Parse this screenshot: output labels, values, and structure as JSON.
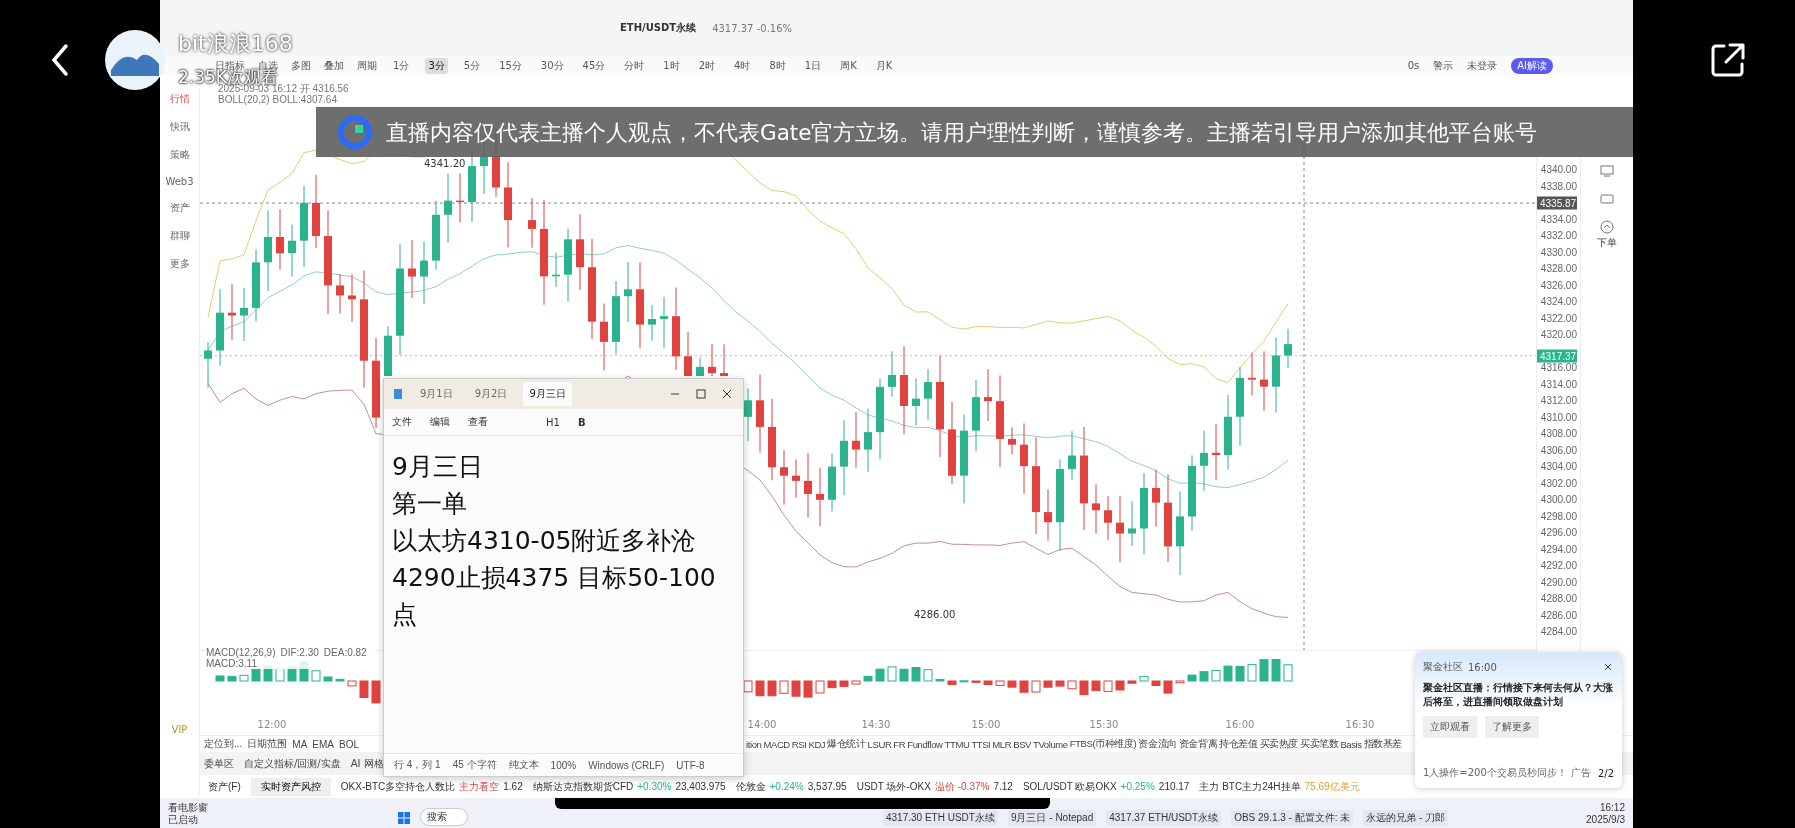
{
  "stream": {
    "streamer": "bit浪浪168",
    "views": "2.35K次观看"
  },
  "notice": "直播内容仅代表主播个人观点，不代表Gate官方立场。请用户理性判断，谨慎参考。主播若引导用户添加其他平台账号",
  "tickers": [
    {
      "symbol": "ETH/USDT永续",
      "quote": "4317.37 -0.16%"
    }
  ],
  "toolbar": {
    "tools": [
      "日指标",
      "自选",
      "多图",
      "叠加"
    ],
    "period_label": "周期",
    "periods": [
      {
        "label": "1分",
        "selected": false
      },
      {
        "label": "3分",
        "selected": true
      },
      {
        "label": "5分",
        "selected": false
      },
      {
        "label": "15分",
        "selected": false
      },
      {
        "label": "30分",
        "selected": false
      },
      {
        "label": "45分",
        "selected": false
      },
      {
        "label": "分时",
        "selected": false
      },
      {
        "label": "1时",
        "selected": false
      },
      {
        "label": "2时",
        "selected": false
      },
      {
        "label": "4时",
        "selected": false
      },
      {
        "label": "8时",
        "selected": false
      },
      {
        "label": "1日",
        "selected": false
      },
      {
        "label": "周K",
        "selected": false
      },
      {
        "label": "月K",
        "selected": false
      }
    ],
    "right": [
      "0s",
      "警示",
      "未登录"
    ],
    "ai_button": "AI解读"
  },
  "sidebar": {
    "items": [
      {
        "label": "行情",
        "selected": true
      },
      {
        "label": "快讯",
        "selected": false
      },
      {
        "label": "策略",
        "selected": false
      },
      {
        "label": "Web3",
        "selected": false
      },
      {
        "label": "资产",
        "selected": false
      },
      {
        "label": "群聊",
        "selected": false
      },
      {
        "label": "更多",
        "selected": false
      }
    ],
    "vip": "VIP"
  },
  "legend": [
    "2025-09-03 16:12 开 4316.56",
    "BOLL(20,2) BOLL:4307.64"
  ],
  "right_tools": {
    "order": "下单"
  },
  "price_axis": [
    "4340.00",
    "4338.00",
    "4334.00",
    "4332.00",
    "4330.00",
    "4328.00",
    "4326.00",
    "4324.00",
    "4322.00",
    "4320.00",
    "4316.00",
    "4314.00",
    "4312.00",
    "4310.00",
    "4308.00",
    "4306.00",
    "4304.00",
    "4302.00",
    "4300.00",
    "4298.00",
    "4296.00",
    "4294.00",
    "4292.00",
    "4290.00",
    "4288.00",
    "4286.00",
    "4284.00"
  ],
  "price_tags": [
    {
      "text": "4335.87",
      "kind": "crosshair"
    },
    {
      "text": "4317.37",
      "kind": "last"
    }
  ],
  "chart_marks": [
    {
      "text": "4341.20",
      "kind": "high"
    },
    {
      "text": "4286.00",
      "kind": "low"
    }
  ],
  "macd_legend": [
    "MACD(12,26,9)",
    "DIF:2.30",
    "DEA:0.82",
    "MACD:3.11"
  ],
  "time_axis": [
    "12:00",
    "14:00",
    "14:30",
    "15:00",
    "15:30",
    "16:00",
    "16:30"
  ],
  "indicator_bar": {
    "left": [
      "定位到...",
      "日期范围"
    ],
    "indicators": [
      "MA",
      "EMA",
      "BOL",
      "ition",
      "MACD",
      "RSI",
      "KDJ",
      "爆仓统计",
      "LSUR",
      "FR",
      "Fundflow",
      "TTMU",
      "TTSI",
      "MLR",
      "BSV",
      "TVolume",
      "FTBS(币种维度)",
      "资金流向",
      "资金背离",
      "持仓差值",
      "买卖热度",
      "买卖笔数",
      "Basis",
      "指数基差"
    ]
  },
  "panel_tabs": [
    "委单区",
    "自定义指标/回测/实盘",
    "AI 网格"
  ],
  "asset_bar": {
    "label": "资产(F)",
    "button": "实时资产风控",
    "items": [
      {
        "name": "OKX-BTC多空持仓人数比",
        "change": "主力看空",
        "value": "1.62",
        "kind": "down"
      },
      {
        "name": "纳斯达克指数期货CFD",
        "change": "+0.30%",
        "value": "23,403.975",
        "kind": "up"
      },
      {
        "name": "伦敦金",
        "change": "+0.24%",
        "value": "3,537.95",
        "kind": "up"
      },
      {
        "name": "USDT 场外-OKX",
        "change": "溢价 -0.37%",
        "value": "7.12",
        "kind": "down"
      },
      {
        "name": "SOL/USDT 欧易OKX",
        "change": "+0.25%",
        "value": "210.17",
        "kind": "up"
      },
      {
        "name": "主力  BTC主力24H挂单",
        "change": "75.69亿美元",
        "value": "",
        "kind": "warn"
      }
    ]
  },
  "notepad": {
    "tabs": [
      {
        "label": "9月1日",
        "selected": false
      },
      {
        "label": "9月2日",
        "selected": false
      },
      {
        "label": "9月三日",
        "selected": true
      }
    ],
    "menu": [
      "文件",
      "编辑",
      "查看"
    ],
    "heading": "H1",
    "format": [
      "B"
    ],
    "lines": [
      "9月三日",
      "第一单",
      "以太坊4310-05附近多补沧",
      "4290止损4375 目标50-100",
      "点"
    ],
    "status": [
      "行 4，列 1",
      "45 个字符",
      "纯文本",
      "100%",
      "Windows (CRLF)",
      "UTF-8"
    ]
  },
  "popup": {
    "source": "聚金社区",
    "time": "16:00",
    "message": "聚金社区直播：行情接下来何去何从？大涨后将至，进直播间领取做盘计划",
    "buttons": [
      "立即观看",
      "了解更多"
    ],
    "footer": "1人操作=200个交易员秒同步！",
    "ad": "广告",
    "page": "2/2"
  },
  "taskbar": {
    "widget": [
      "看电影窗",
      "已启动"
    ],
    "search": "搜索",
    "apps": [
      "4317.30 ETH USDT永续",
      "9月三日 - Notepad",
      "4317.37 ETH/USDT永续",
      "OBS 29.1.3 - 配置文件: 未",
      "永远的兄弟 - 刀郎"
    ],
    "clock": [
      "16:12",
      "2025/9/3"
    ]
  }
}
